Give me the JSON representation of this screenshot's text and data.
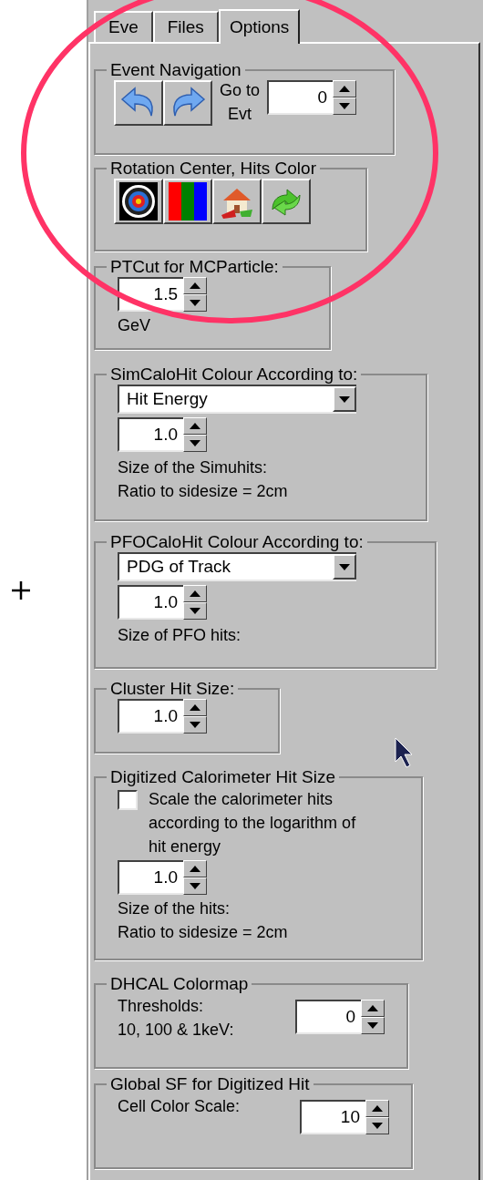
{
  "tabs": [
    {
      "label": "Eve",
      "selected": false
    },
    {
      "label": "Files",
      "selected": false
    },
    {
      "label": "Options",
      "selected": true
    }
  ],
  "groups": [
    {
      "kind": "navigation",
      "title": "Event Navigation",
      "label_lines": [
        "Go to",
        "Evt"
      ],
      "value": "0"
    },
    {
      "kind": "icons",
      "title": "Rotation Center, Hits Color"
    },
    {
      "kind": "spinner",
      "title": "PTCut for MCParticle:",
      "value": "1.5",
      "notes": [
        "GeV"
      ]
    },
    {
      "kind": "combo",
      "title": "SimCaloHit Colour According to:",
      "selection": "Hit Energy",
      "value": "1.0",
      "notes": [
        "Size of the Simuhits:",
        "Ratio to sidesize = 2cm"
      ]
    },
    {
      "kind": "combo",
      "title": "PFOCaloHit Colour According to:",
      "selection": "PDG of Track",
      "value": "1.0",
      "notes": [
        "Size of PFO hits:"
      ]
    },
    {
      "kind": "spinner",
      "title": "Cluster Hit Size:",
      "value": "1.0"
    },
    {
      "kind": "checkbox",
      "title": "Digitized Calorimeter Hit Size",
      "checkbox": {
        "label": "Scale the calorimeter hits according to the logarithm of hit energy",
        "checked": false
      },
      "value": "1.0",
      "notes": [
        "Size of the hits:",
        "Ratio to sidesize = 2cm"
      ]
    },
    {
      "kind": "side_spinner",
      "title": "DHCAL Colormap",
      "notes": [
        "Thresholds:",
        "10, 100 & 1keV:"
      ],
      "value": "0"
    },
    {
      "kind": "side_spinner",
      "title": "Global SF for Digitized Hit",
      "notes": [
        "Cell Color Scale:"
      ],
      "value": "10"
    }
  ]
}
